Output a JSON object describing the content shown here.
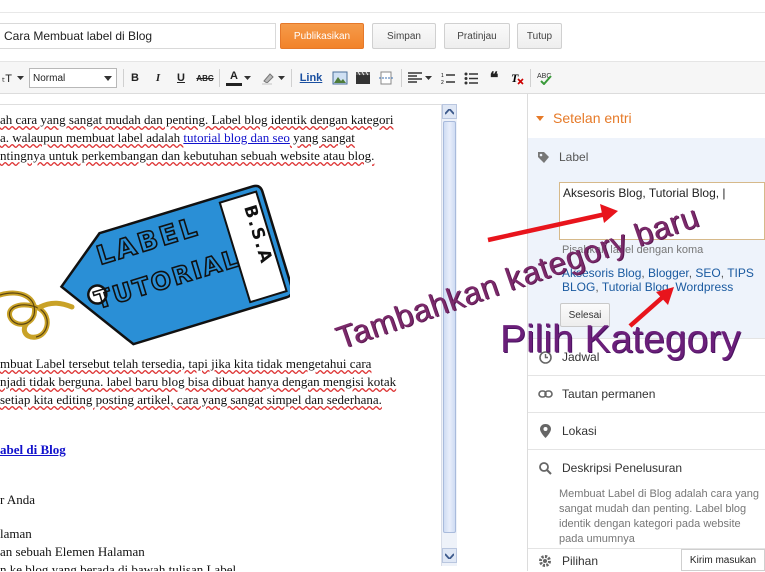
{
  "header": {
    "post_title": "Cara Membuat label di Blog",
    "buttons": {
      "publish": "Publikasikan",
      "save": "Simpan",
      "preview": "Pratinjau",
      "close": "Tutup"
    }
  },
  "toolbar": {
    "font_size_icon": "ₜT",
    "format_value": "Normal",
    "bold": "B",
    "italic": "I",
    "underline": "U",
    "strike": "ABC",
    "text_color": "A",
    "link": "Link"
  },
  "editor": {
    "lines": [
      {
        "text": "ah cara yang sangat mudah dan penting. Label blog identik dengan kategori"
      },
      {
        "pre": "a.  walaupun membuat label adalah ",
        "link": "tutorial blog dan seo",
        "post": " yang sangat"
      },
      {
        "text": "ntingnya untuk perkembangan dan kebutuhan sebuah website atau blog."
      },
      {
        "text": "mbuat Label tersebut telah tersedia, tapi jika kita tidak mengetahui cara"
      },
      {
        "text": "njadi tidak berguna. label baru blog bisa dibuat hanya dengan mengisi kotak"
      },
      {
        "text": "setiap kita editing posting artikel, cara yang sangat simpel dan sederhana."
      },
      {
        "link": "abel di Blog"
      },
      {
        "text": "r Anda"
      },
      {
        "text": "laman"
      },
      {
        "text": "an sebuah Elemen Halaman"
      },
      {
        "text": "n ke blog yang berada di bawah tulisan Label"
      }
    ],
    "tag_image": {
      "label_text": "LABEL",
      "tutorial_text": "TUTORIAL",
      "side_text": "B.S.A"
    }
  },
  "sidebar": {
    "header": "Setelan entri",
    "label_section": {
      "title": "Label",
      "value": "Aksesoris Blog, Tutorial Blog, |",
      "hint": "Pisahkan label dengan koma",
      "existing_labels": [
        "Aksesoris Blog",
        "Blogger",
        "SEO",
        "TIPS BLOG",
        "Tutorial Blog",
        "Wordpress"
      ],
      "done_button": "Selesai"
    },
    "items": [
      {
        "label": "Jadwal",
        "icon": "clock-icon"
      },
      {
        "label": "Tautan permanen",
        "icon": "link-icon"
      },
      {
        "label": "Lokasi",
        "icon": "pin-icon"
      },
      {
        "label": "Deskripsi Penelusuran",
        "icon": "search-icon"
      }
    ],
    "search_description": "Membuat Label di Blog adalah cara yang sangat mudah dan penting. Label blog identik dengan kategori pada website pada umumnya",
    "options": {
      "label": "Pilihan",
      "icon": "gear-icon"
    }
  },
  "feedback": "Kirim masukan",
  "annotations": {
    "add_new": "Tambahkan kategory baru",
    "choose": "Pilih Kategory"
  },
  "colors": {
    "accent": "#e67a28",
    "publish": "#f2832a",
    "link": "#1a5aa0",
    "annotation": "#6b1f7a",
    "arrow": "#e8141c",
    "tag_blue": "#2a8fd6"
  }
}
